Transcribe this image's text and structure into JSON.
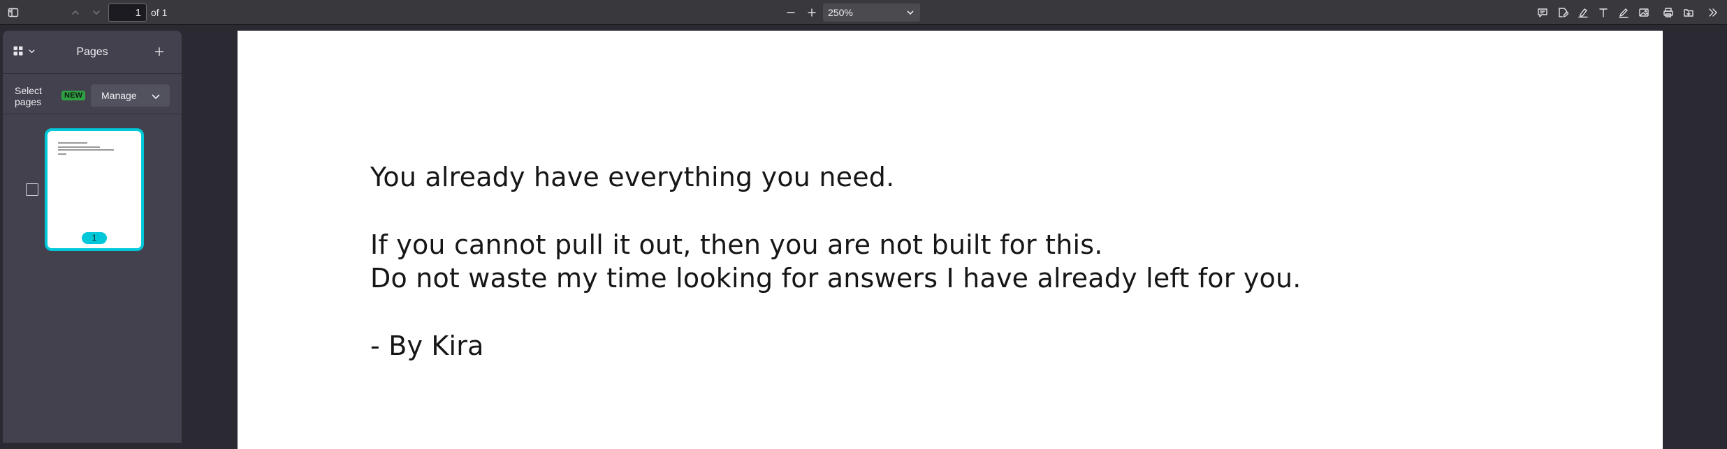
{
  "toolbar": {
    "page_number": "1",
    "page_count": "of 1",
    "zoom_value": "250%"
  },
  "sidebar": {
    "title": "Pages",
    "select_pages_label": "Select pages",
    "new_badge": "NEW",
    "manage_label": "Manage",
    "thumbnails": [
      {
        "page_label": "1"
      }
    ]
  },
  "document": {
    "lines": [
      "You already have everything you need.",
      "If you cannot pull it out, then you are not built for this.",
      "Do not waste my time looking for answers I have already left for you.",
      "- By Kira"
    ]
  },
  "colors": {
    "accent": "#00c8d8",
    "new_badge": "#2ea043",
    "toolbar": "#38383d",
    "sidebar": "#42414d",
    "canvas": "#2b2a33"
  },
  "icons": [
    "sidebar-toggle-icon",
    "arrow-up-icon",
    "arrow-down-icon",
    "zoom-out-icon",
    "zoom-in-icon",
    "chevron-down-icon",
    "comment-icon",
    "edit-icon",
    "highlight-icon",
    "text-icon",
    "draw-icon",
    "image-icon",
    "print-icon",
    "save-icon",
    "more-tools-icon",
    "grid-view-icon",
    "add-page-icon"
  ]
}
